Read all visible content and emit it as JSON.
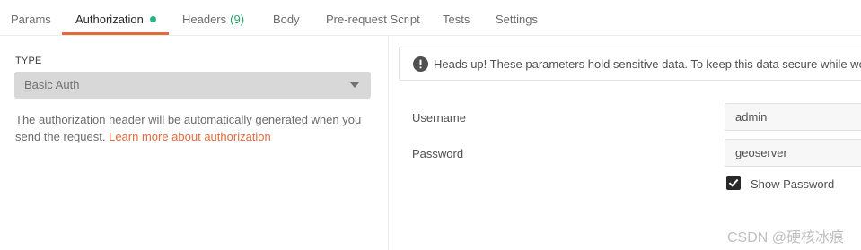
{
  "tabs": {
    "params": "Params",
    "authorization": "Authorization",
    "headers": "Headers",
    "headers_count": "(9)",
    "body": "Body",
    "prerequest": "Pre-request Script",
    "tests": "Tests",
    "settings": "Settings"
  },
  "auth": {
    "type_label": "TYPE",
    "type_value": "Basic Auth",
    "description": "The authorization header will be automatically generated when you send the request.",
    "learn_more": "Learn more about authorization"
  },
  "alert": {
    "icon": "exclamation-circle-icon",
    "text": "Heads up! These parameters hold sensitive data. To keep this data secure while worki"
  },
  "form": {
    "username_label": "Username",
    "username_value": "admin",
    "password_label": "Password",
    "password_value": "geoserver",
    "show_password_label": "Show Password",
    "show_password_checked": true
  },
  "watermark": "CSDN @硬核冰痕",
  "colors": {
    "accent": "#e46a3e",
    "status_dot": "#26b47f",
    "count": "#26a36a"
  }
}
